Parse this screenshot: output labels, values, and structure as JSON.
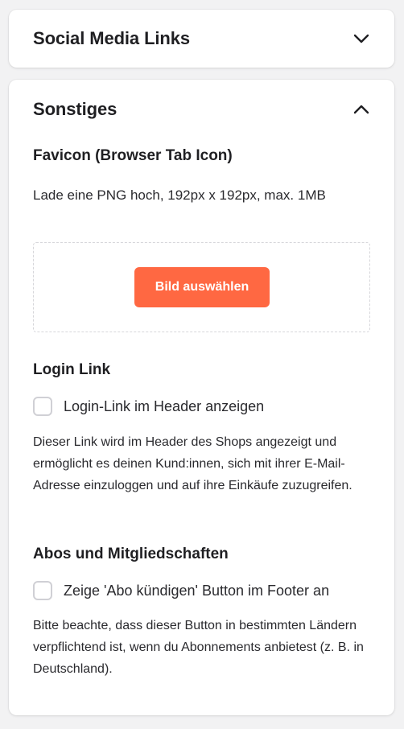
{
  "social_card": {
    "title": "Social Media Links",
    "toggle_icon": "chevron-down-icon"
  },
  "other_card": {
    "title": "Sonstiges",
    "toggle_icon": "chevron-up-icon",
    "favicon": {
      "title": "Favicon (Browser Tab Icon)",
      "description": "Lade eine PNG hoch, 192px x 192px, max. 1MB",
      "button_label": "Bild auswählen"
    },
    "login_link": {
      "title": "Login Link",
      "checkbox_label": "Login-Link im Header anzeigen",
      "checked": false,
      "description": "Dieser Link wird im Header des Shops angezeigt und ermöglicht es deinen Kund:innen, sich mit ihrer E-Mail-Adresse einzuloggen und auf ihre Einkäufe zuzugreifen."
    },
    "subscriptions": {
      "title": "Abos und Mitgliedschaften",
      "checkbox_label": "Zeige 'Abo kündigen' Button im Footer an",
      "checked": false,
      "description": "Bitte beachte, dass dieser Button in bestimmten Ländern verpflichtend ist, wenn du Abonnements anbietest (z. B. in Deutschland)."
    }
  },
  "colors": {
    "accent": "#ff6842",
    "background": "#f2f2f3",
    "card": "#ffffff",
    "text": "#1f1f22"
  }
}
